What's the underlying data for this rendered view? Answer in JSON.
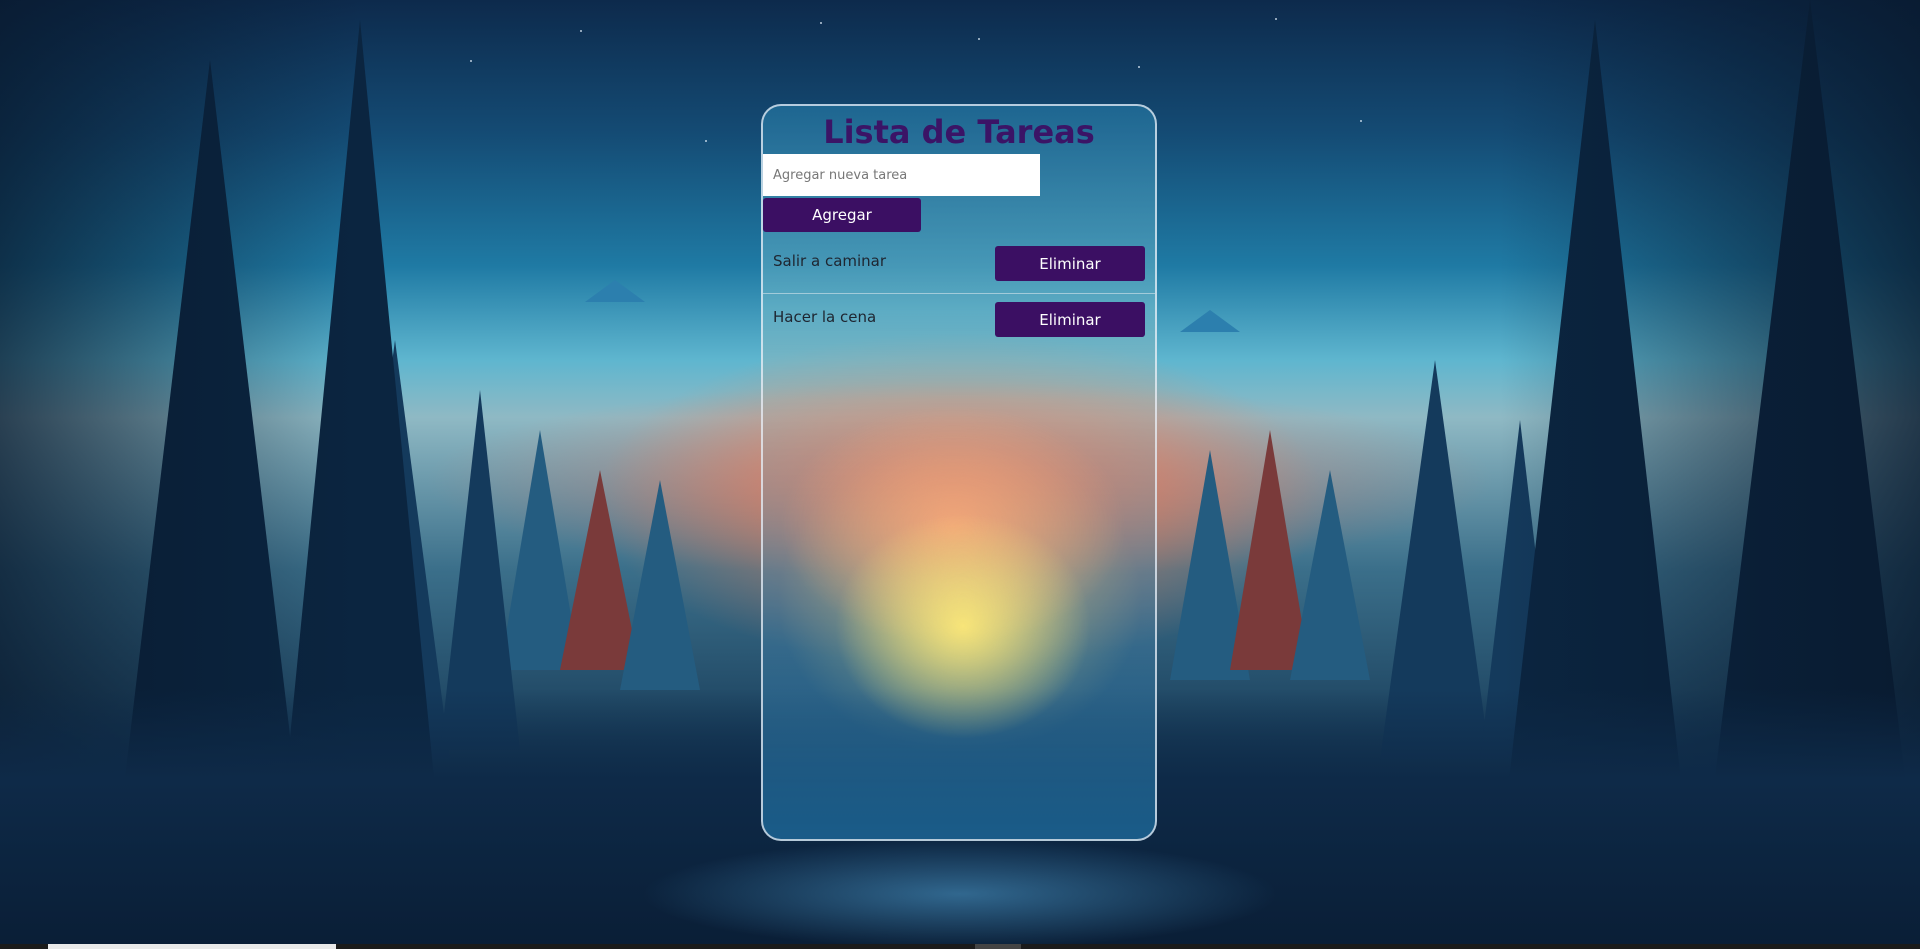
{
  "app": {
    "title": "Lista de Tareas"
  },
  "new_task": {
    "placeholder": "Agregar nueva tarea",
    "value": "",
    "add_label": "Agregar"
  },
  "tasks": [
    {
      "text": "Salir a caminar",
      "delete_label": "Eliminar"
    },
    {
      "text": "Hacer la cena",
      "delete_label": "Eliminar"
    }
  ],
  "colors": {
    "title": "#3b1466",
    "button_bg": "#3b0f63",
    "button_text": "#ffffff"
  }
}
